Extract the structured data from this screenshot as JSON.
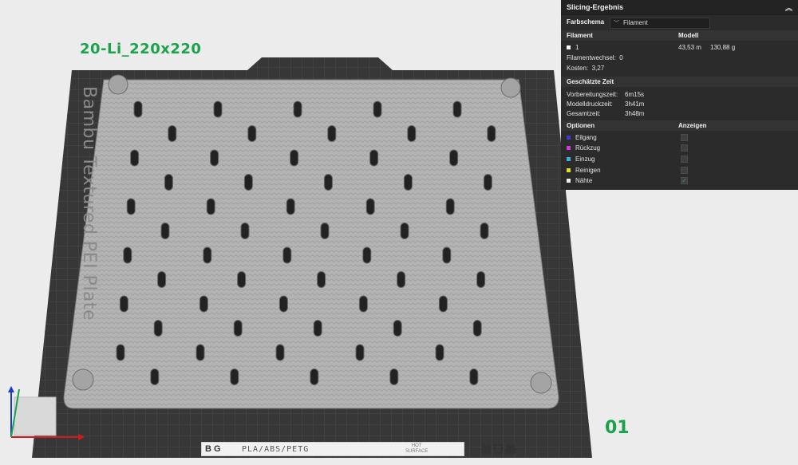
{
  "viewport": {
    "plate_name": "20-Li_220x220",
    "plate_number": "01",
    "bed_label": "Bambu Textured PEI Plate",
    "bottom_bar": {
      "logo": "B G",
      "materials": "PLA/ABS/PETG",
      "hot_surface_line1": "HOT",
      "hot_surface_line2": "SURFACE"
    },
    "colors": {
      "plate_name": "#1aa34a",
      "plate_number": "#1aa34a",
      "bed": "#3a3a3a",
      "part": "#b6b6b6"
    }
  },
  "panel": {
    "title": "Slicing-Ergebnis",
    "collapse_icon": "chevron-up-icon",
    "color_scheme_label": "Farbschema",
    "color_scheme_value": "Filament",
    "table_headers": {
      "filament": "Filament",
      "model": "Modell"
    },
    "filament_row": {
      "id": "1",
      "length": "43,53 m",
      "weight": "130,88 g",
      "color": "#ffffff"
    },
    "filament_changes_label": "Filamentwechsel:",
    "filament_changes_value": "0",
    "cost_label": "Kosten:",
    "cost_value": "3,27",
    "time_header": "Geschätzte Zeit",
    "times": [
      {
        "label": "Vorbereitungszeit:",
        "value": "6m15s"
      },
      {
        "label": "Modelldruckzeit:",
        "value": "3h41m"
      },
      {
        "label": "Gesamtzeit:",
        "value": "3h48m"
      }
    ],
    "options_header": "Optionen",
    "show_header": "Anzeigen",
    "options": [
      {
        "label": "Eilgang",
        "color": "#3a3ad6",
        "checked": false
      },
      {
        "label": "Rückzug",
        "color": "#d63ad6",
        "checked": false
      },
      {
        "label": "Einzug",
        "color": "#3ab0d6",
        "checked": false
      },
      {
        "label": "Reinigen",
        "color": "#e0e020",
        "checked": false
      },
      {
        "label": "Nähte",
        "color": "#f0f0f0",
        "checked": true
      }
    ]
  }
}
